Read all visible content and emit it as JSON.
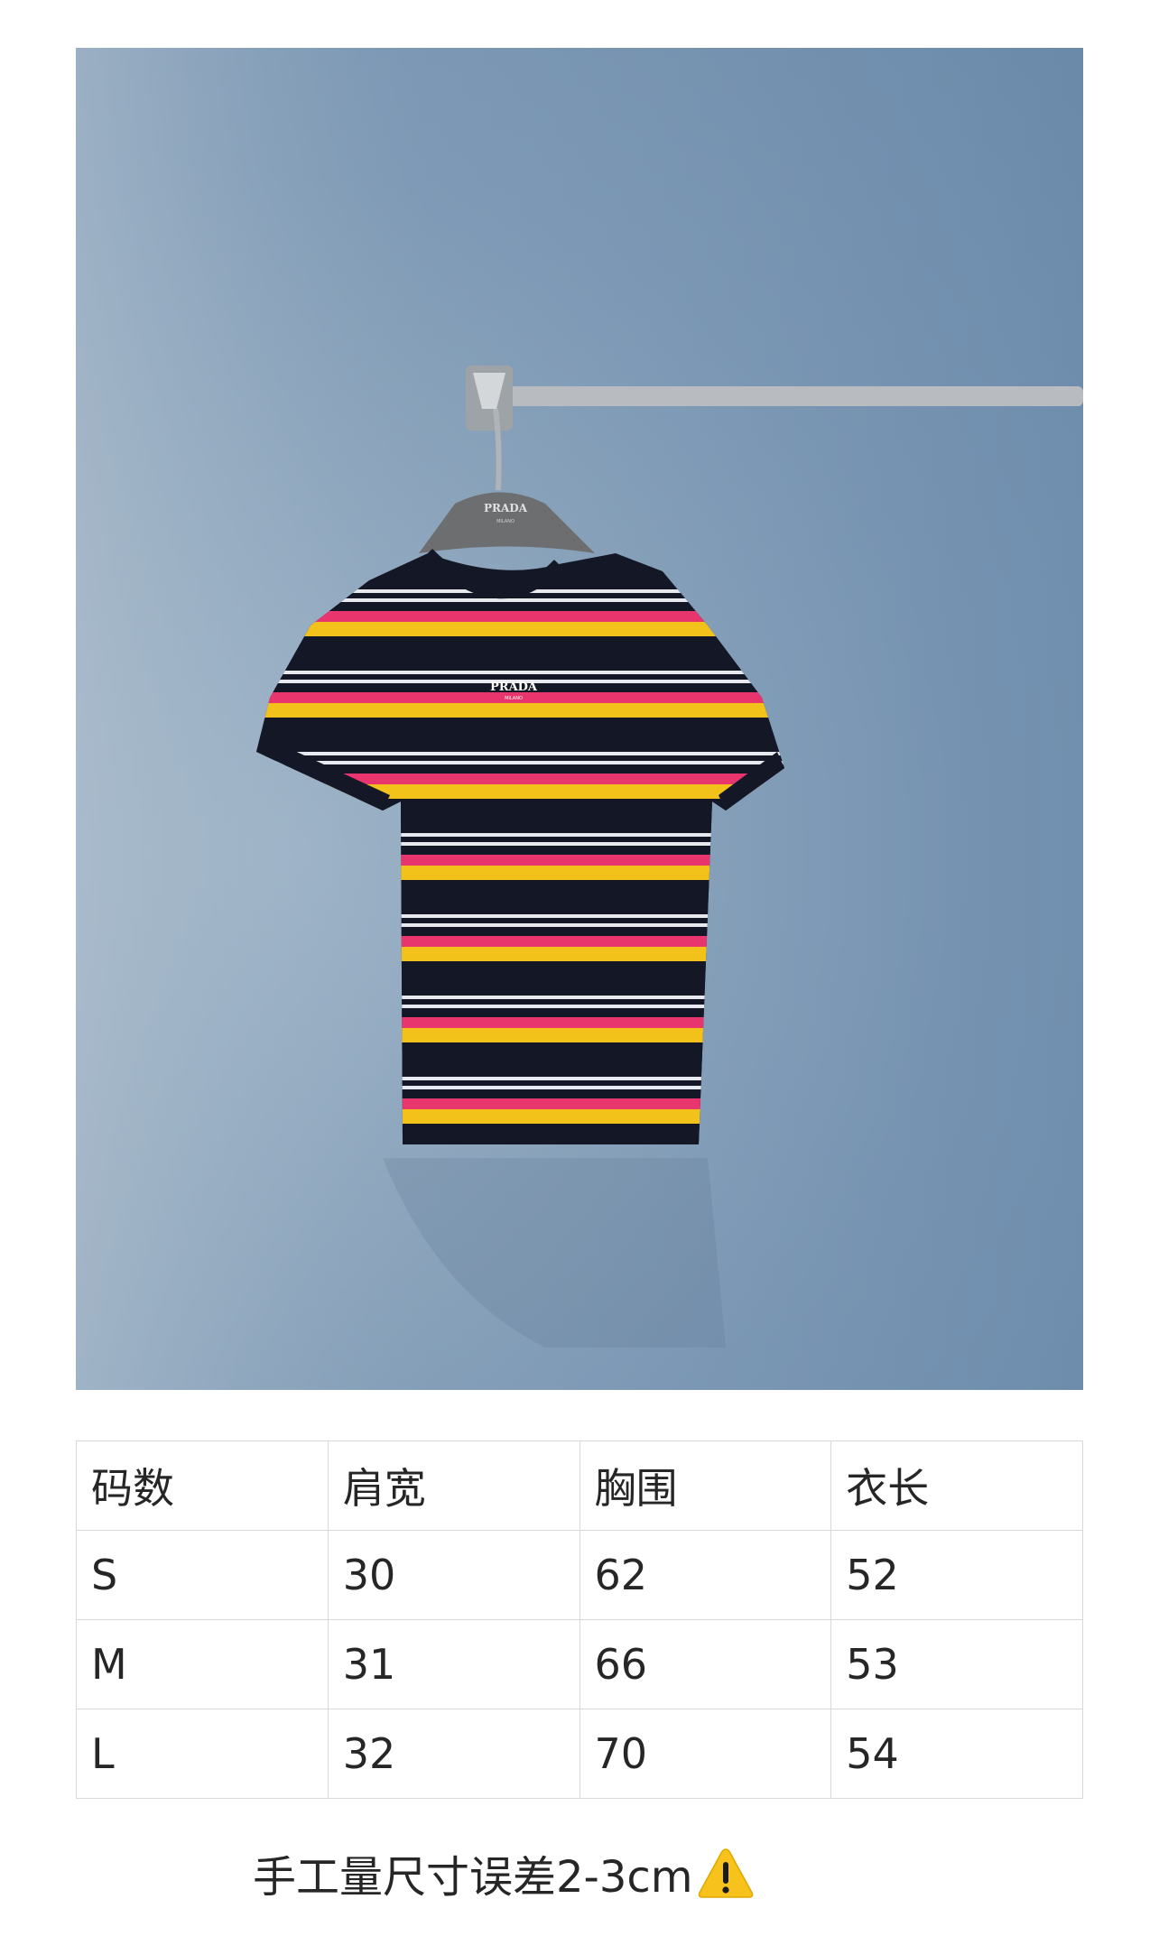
{
  "product_photo": {
    "hanger_brand": "PRADA",
    "hanger_sub": "MILANO",
    "shirt_brand": "PRADA",
    "shirt_sub": "MILANO"
  },
  "size_table": {
    "headers": [
      "码数",
      "肩宽",
      "胸围",
      "衣长"
    ],
    "rows": [
      [
        "S",
        "30",
        "62",
        "52"
      ],
      [
        "M",
        "31",
        "66",
        "53"
      ],
      [
        "L",
        "32",
        "70",
        "54"
      ]
    ]
  },
  "note": {
    "text": "手工量尺寸误差2-3cm",
    "icon": "warning-icon"
  },
  "colors": {
    "wall": "#7a96b3",
    "shirt_navy": "#141826",
    "stripe_yellow": "#f2c21a",
    "stripe_pink": "#e8356e",
    "stripe_white": "#e8e8ef"
  }
}
